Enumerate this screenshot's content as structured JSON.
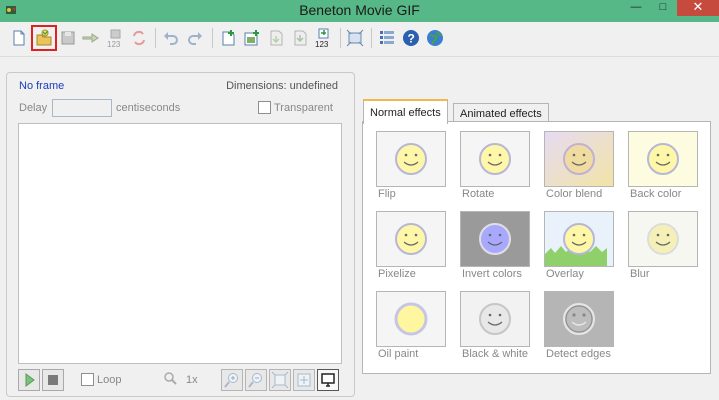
{
  "window": {
    "title": "Beneton Movie GIF",
    "minimize": "—",
    "maximize": "□",
    "close": "✕"
  },
  "toolbar": {
    "buttons": [
      {
        "name": "new-file",
        "icon": "new-file-icon"
      },
      {
        "name": "open-file",
        "icon": "open-folder-icon",
        "highlighted": true
      },
      {
        "name": "save",
        "icon": "save-icon"
      },
      {
        "name": "export",
        "icon": "export-icon"
      },
      {
        "name": "save-sequence",
        "icon": "save-sequence-icon",
        "caption": "123"
      },
      {
        "name": "convert",
        "icon": "convert-icon"
      },
      {
        "name": "undo",
        "icon": "undo-icon"
      },
      {
        "name": "redo",
        "icon": "redo-icon"
      },
      {
        "name": "add-frame",
        "icon": "add-frame-icon"
      },
      {
        "name": "insert-image",
        "icon": "insert-image-icon"
      },
      {
        "name": "import",
        "icon": "import-icon"
      },
      {
        "name": "move-down",
        "icon": "move-down-icon"
      },
      {
        "name": "import-sequence",
        "icon": "import-sequence-icon",
        "caption": "123"
      },
      {
        "name": "resize",
        "icon": "resize-icon"
      },
      {
        "name": "frame-list",
        "icon": "list-icon"
      },
      {
        "name": "help",
        "icon": "help-icon"
      },
      {
        "name": "website",
        "icon": "globe-icon"
      }
    ]
  },
  "frame": {
    "name": "No frame",
    "dimensions": "Dimensions: undefined",
    "delay_label": "Delay",
    "delay_value": "",
    "delay_unit": "centiseconds",
    "transparent_label": "Transparent",
    "transparent_checked": false
  },
  "playback": {
    "loop_label": "Loop",
    "loop_checked": false,
    "zoom": "1x"
  },
  "tabs": [
    {
      "label": "Normal effects",
      "active": true
    },
    {
      "label": "Animated effects",
      "active": false
    }
  ],
  "effects": [
    {
      "label": "Flip",
      "style": "plain"
    },
    {
      "label": "Rotate",
      "style": "plain"
    },
    {
      "label": "Color blend",
      "style": "blend"
    },
    {
      "label": "Back color",
      "style": "backcolor"
    },
    {
      "label": "Pixelize",
      "style": "plain"
    },
    {
      "label": "Invert colors",
      "style": "invert"
    },
    {
      "label": "Overlay",
      "style": "overlay"
    },
    {
      "label": "Blur",
      "style": "blur"
    },
    {
      "label": "Oil paint",
      "style": "oil"
    },
    {
      "label": "Black & white",
      "style": "bw"
    },
    {
      "label": "Detect edges",
      "style": "edges"
    }
  ],
  "colors": {
    "titlebar": "#56b886",
    "close_button": "#c74a3f",
    "active_tab_accent": "#f2b84b",
    "frame_label": "#1a3db8",
    "highlight_outline": "#dd2222"
  }
}
